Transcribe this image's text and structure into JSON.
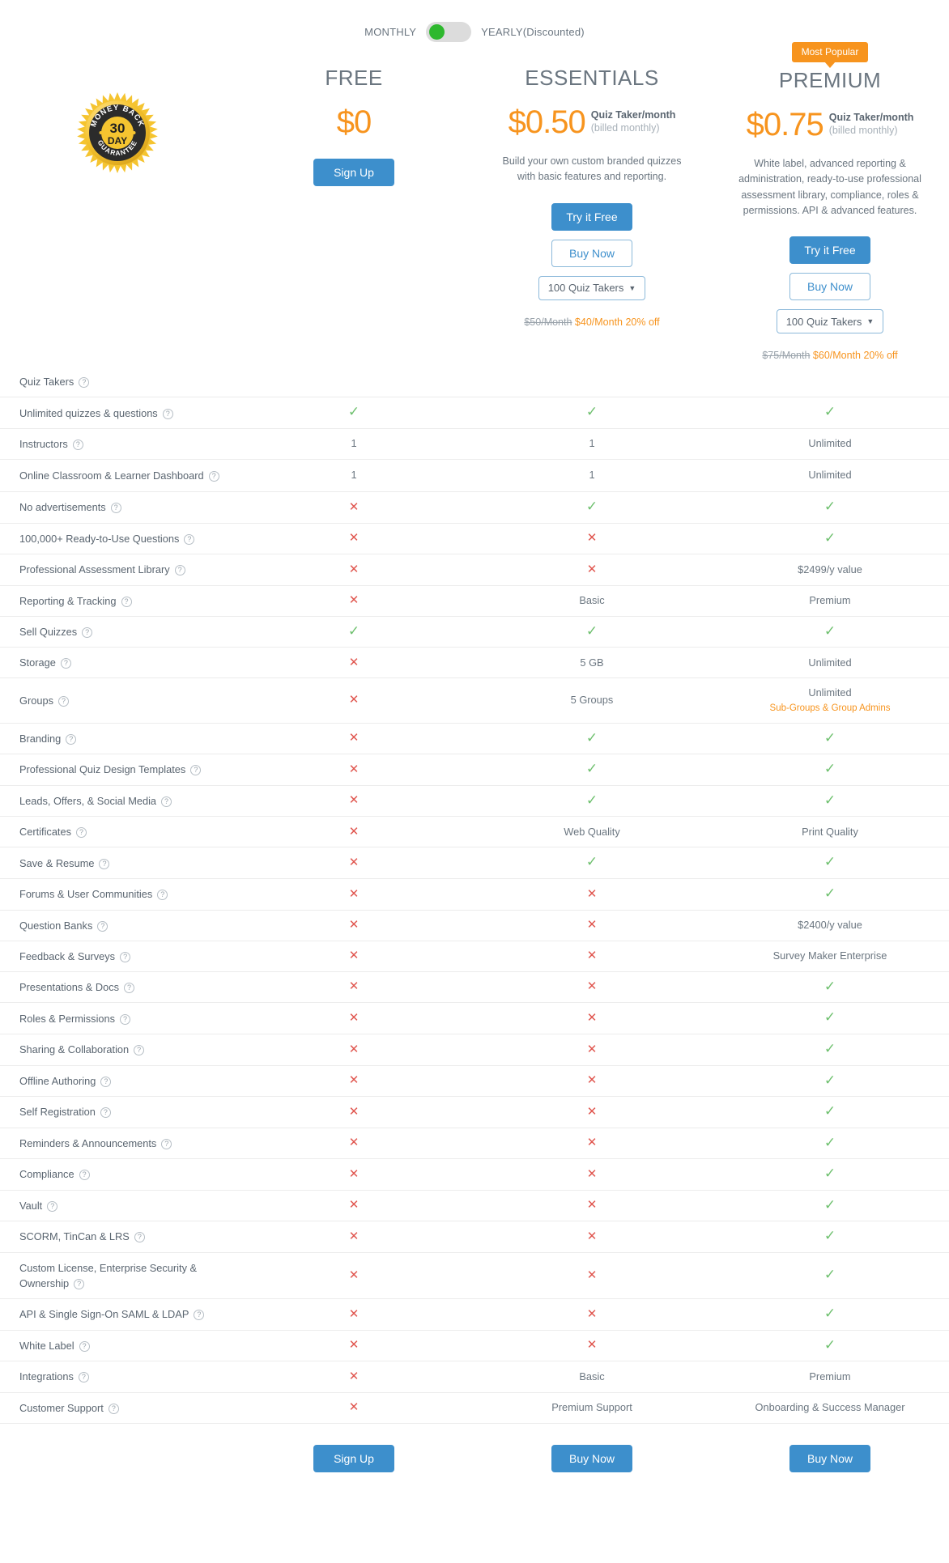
{
  "billing": {
    "monthly_label": "MONTHLY",
    "yearly_label": "YEARLY(Discounted)",
    "selected": "MONTHLY"
  },
  "seal": {
    "line1": "MONEY BACK",
    "number": "30",
    "unit": "DAY",
    "line2": "GUARANTEE"
  },
  "colors": {
    "accent_orange": "#f7941e",
    "primary_blue": "#3d8fcc",
    "tick_green": "#6ec06e",
    "cross_red": "#e0564f"
  },
  "plans": {
    "free": {
      "name": "FREE",
      "price": "$0",
      "cta_primary": "Sign Up",
      "footer_cta": "Sign Up"
    },
    "essentials": {
      "name": "ESSENTIALS",
      "price": "$0.50",
      "unit_line1": "Quiz Taker/month",
      "unit_line2": "(billed monthly)",
      "description": "Build your own custom branded quizzes with basic features and reporting.",
      "cta_primary": "Try it Free",
      "cta_secondary": "Buy Now",
      "quiz_takers_select": "100 Quiz Takers",
      "price_old": "$50/Month",
      "price_new": "$40/Month 20% off",
      "footer_cta": "Buy Now"
    },
    "premium": {
      "badge": "Most Popular",
      "name": "PREMIUM",
      "price": "$0.75",
      "unit_line1": "Quiz Taker/month",
      "unit_line2": "(billed monthly)",
      "description": "White label, advanced reporting & administration, ready-to-use professional assessment library, compliance, roles & permissions. API & advanced features.",
      "cta_primary": "Try it Free",
      "cta_secondary": "Buy Now",
      "quiz_takers_select": "100 Quiz Takers",
      "price_old": "$75/Month",
      "price_new": "$60/Month 20% off",
      "footer_cta": "Buy Now"
    }
  },
  "quiz_takers_row_label": "Quiz Takers",
  "features": [
    {
      "label": "Unlimited quizzes & questions",
      "free": "check",
      "essentials": "check",
      "premium": "check"
    },
    {
      "label": "Instructors",
      "free": "1",
      "essentials": "1",
      "premium": "Unlimited"
    },
    {
      "label": "Online Classroom & Learner Dashboard",
      "free": "1",
      "essentials": "1",
      "premium": "Unlimited"
    },
    {
      "label": "No advertisements",
      "free": "cross",
      "essentials": "check",
      "premium": "check"
    },
    {
      "label": "100,000+ Ready-to-Use Questions",
      "free": "cross",
      "essentials": "cross",
      "premium": "check"
    },
    {
      "label": "Professional Assessment Library",
      "free": "cross",
      "essentials": "cross",
      "premium": "$2499/y value"
    },
    {
      "label": "Reporting & Tracking",
      "free": "cross",
      "essentials": "Basic",
      "premium": "Premium"
    },
    {
      "label": "Sell Quizzes",
      "free": "check",
      "essentials": "check",
      "premium": "check"
    },
    {
      "label": "Storage",
      "free": "cross",
      "essentials": "5 GB",
      "premium": "Unlimited"
    },
    {
      "label": "Groups",
      "free": "cross",
      "essentials": "5 Groups",
      "premium": "Unlimited",
      "premium_note": "Sub-Groups & Group Admins"
    },
    {
      "label": "Branding",
      "free": "cross",
      "essentials": "check",
      "premium": "check"
    },
    {
      "label": "Professional Quiz Design Templates",
      "free": "cross",
      "essentials": "check",
      "premium": "check"
    },
    {
      "label": "Leads, Offers, & Social Media",
      "free": "cross",
      "essentials": "check",
      "premium": "check"
    },
    {
      "label": "Certificates",
      "free": "cross",
      "essentials": "Web Quality",
      "premium": "Print Quality"
    },
    {
      "label": "Save & Resume",
      "free": "cross",
      "essentials": "check",
      "premium": "check"
    },
    {
      "label": "Forums & User Communities",
      "free": "cross",
      "essentials": "cross",
      "premium": "check"
    },
    {
      "label": "Question Banks",
      "free": "cross",
      "essentials": "cross",
      "premium": "$2400/y value"
    },
    {
      "label": "Feedback & Surveys",
      "free": "cross",
      "essentials": "cross",
      "premium": "Survey Maker Enterprise"
    },
    {
      "label": "Presentations & Docs",
      "free": "cross",
      "essentials": "cross",
      "premium": "check"
    },
    {
      "label": "Roles & Permissions",
      "free": "cross",
      "essentials": "cross",
      "premium": "check"
    },
    {
      "label": "Sharing & Collaboration",
      "free": "cross",
      "essentials": "cross",
      "premium": "check"
    },
    {
      "label": "Offline Authoring",
      "free": "cross",
      "essentials": "cross",
      "premium": "check"
    },
    {
      "label": "Self Registration",
      "free": "cross",
      "essentials": "cross",
      "premium": "check"
    },
    {
      "label": "Reminders & Announcements",
      "free": "cross",
      "essentials": "cross",
      "premium": "check"
    },
    {
      "label": "Compliance",
      "free": "cross",
      "essentials": "cross",
      "premium": "check"
    },
    {
      "label": "Vault",
      "free": "cross",
      "essentials": "cross",
      "premium": "check"
    },
    {
      "label": "SCORM, TinCan & LRS",
      "free": "cross",
      "essentials": "cross",
      "premium": "check"
    },
    {
      "label": "Custom License, Enterprise Security & Ownership",
      "free": "cross",
      "essentials": "cross",
      "premium": "check"
    },
    {
      "label": "API & Single Sign-On SAML & LDAP",
      "free": "cross",
      "essentials": "cross",
      "premium": "check"
    },
    {
      "label": "White Label",
      "free": "cross",
      "essentials": "cross",
      "premium": "check"
    },
    {
      "label": "Integrations",
      "free": "cross",
      "essentials": "Basic",
      "premium": "Premium"
    },
    {
      "label": "Customer Support",
      "free": "cross",
      "essentials": "Premium Support",
      "premium": "Onboarding & Success Manager"
    }
  ],
  "help_icon": "?"
}
